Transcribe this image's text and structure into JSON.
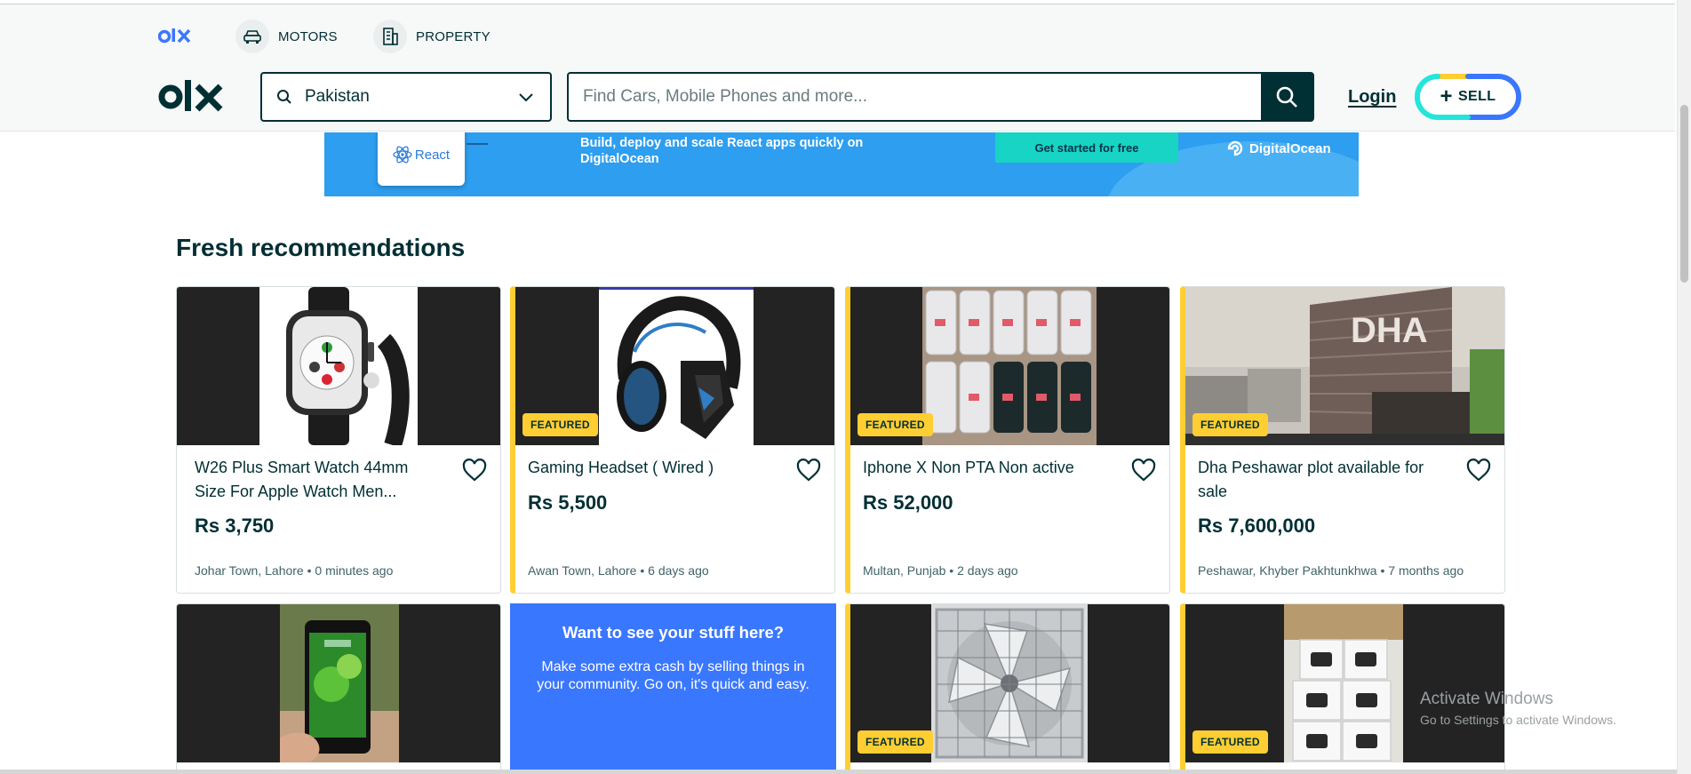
{
  "header": {
    "categories": [
      {
        "label": "MOTORS",
        "icon": "car-icon"
      },
      {
        "label": "PROPERTY",
        "icon": "building-icon"
      }
    ],
    "location": {
      "value": "Pakistan"
    },
    "search": {
      "placeholder": "Find Cars, Mobile Phones and more..."
    },
    "login_label": "Login",
    "sell_label": "SELL",
    "sell_plus": "+"
  },
  "banner": {
    "react_label": "React",
    "text": "Build, deploy and scale React apps quickly on DigitalOcean",
    "cta": "Get started for free",
    "brand": "DigitalOcean"
  },
  "main": {
    "section_title": "Fresh recommendations",
    "badge_label": "FEATURED",
    "listings": [
      {
        "title": "W26 Plus Smart Watch 44mm Size For Apple Watch Men...",
        "price": "Rs 3,750",
        "location": "Johar Town, Lahore",
        "time": "0 minutes ago",
        "featured": false
      },
      {
        "title": "Gaming Headset ( Wired )",
        "price": "Rs 5,500",
        "location": "Awan Town, Lahore",
        "time": "6 days ago",
        "featured": true
      },
      {
        "title": "Iphone X Non PTA Non active",
        "price": "Rs 52,000",
        "location": "Multan, Punjab",
        "time": "2 days ago",
        "featured": true
      },
      {
        "title": "Dha Peshawar plot available for sale",
        "price": "Rs 7,600,000",
        "location": "Peshawar, Khyber Pakhtunkhwa",
        "time": "7 months ago",
        "featured": true
      }
    ],
    "promo": {
      "title": "Want to see your stuff here?",
      "text": "Make some extra cash by selling things in your community. Go on, it's quick and easy."
    },
    "row2": [
      {
        "featured": false
      },
      {
        "featured": true
      },
      {
        "featured": true
      }
    ]
  },
  "windows_watermark": {
    "line1": "Activate Windows",
    "line2": "Go to Settings to activate Windows."
  },
  "colors": {
    "brand": "#002f34",
    "featured": "#ffce32",
    "promo": "#3a77ff",
    "banner": "#2d9ef0"
  }
}
